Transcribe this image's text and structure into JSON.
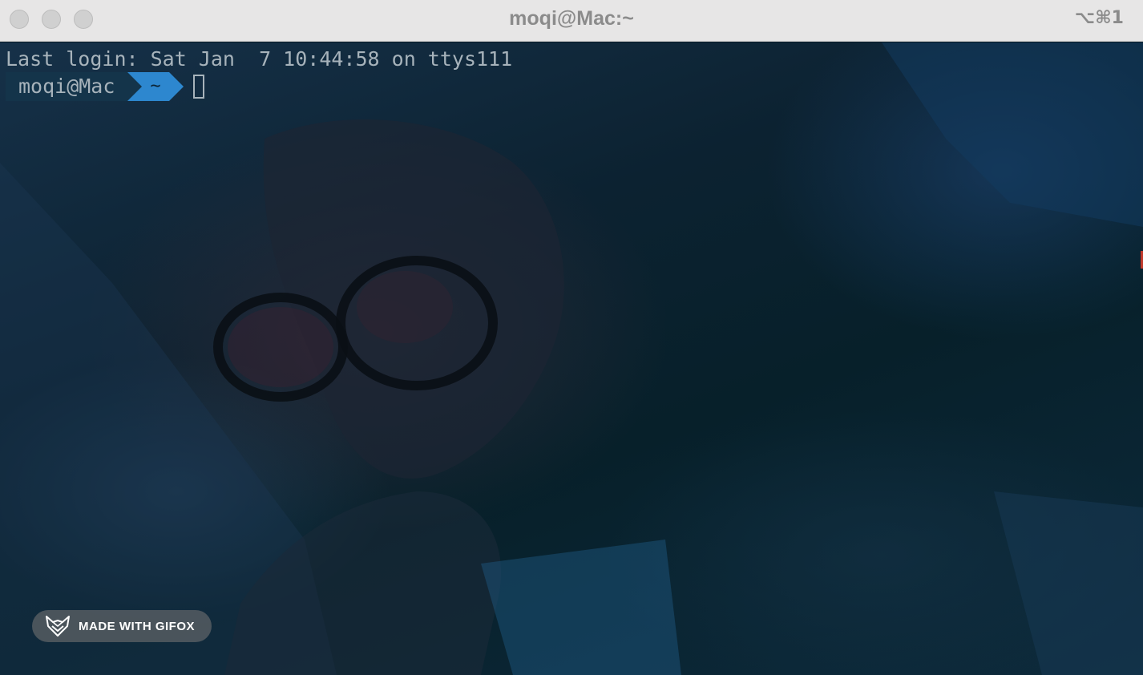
{
  "window": {
    "title": "moqi@Mac:~",
    "shortcut": "⌥⌘1"
  },
  "terminal": {
    "last_login": "Last login: Sat Jan  7 10:44:58 on ttys111",
    "prompt_user": "moqi@Mac",
    "prompt_dir": "~"
  },
  "badge": {
    "icon": "fox-icon",
    "label": "MADE WITH GIFOX"
  },
  "colors": {
    "titlebar": "#e7e6e6",
    "terminal_text": "#a7b3bb",
    "prompt_user_bg": "#14344a",
    "prompt_dir_bg": "#2d87cf"
  }
}
